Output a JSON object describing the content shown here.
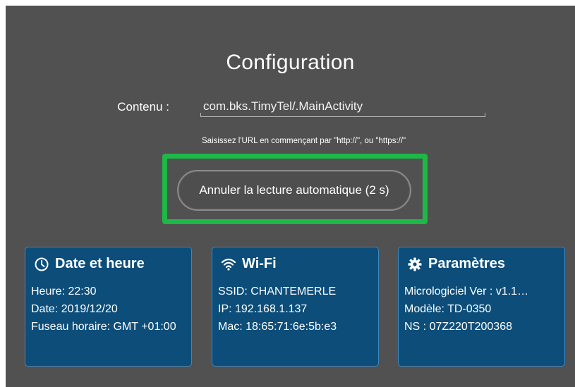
{
  "title": "Configuration",
  "content": {
    "label": "Contenu :",
    "value": "com.bks.TimyTel/.MainActivity",
    "hint": "Saisissez l'URL en commençant par \"http://\", ou \"https://\""
  },
  "cancel_button": "Annuler la lecture automatique (2 s)",
  "colors": {
    "background": "#515151",
    "card": "#0c4d7a",
    "highlight": "#1db846"
  },
  "cards": {
    "datetime": {
      "icon": "clock-icon",
      "title": "Date et heure",
      "heure": "Heure: 22:30",
      "date": "Date: 2019/12/20",
      "fuseau": "Fuseau horaire: GMT +01:00"
    },
    "wifi": {
      "icon": "wifi-icon",
      "title": "Wi-Fi",
      "ssid": "SSID: CHANTEMERLE",
      "ip": "IP: 192.168.1.137",
      "mac": "Mac: 18:65:71:6e:5b:e3"
    },
    "params": {
      "icon": "gear-icon",
      "title": "Paramètres",
      "firmware": "Micrologiciel Ver : v1.1…",
      "model": "Modèle: TD-0350",
      "ns": "NS : 07Z220T200368"
    }
  }
}
